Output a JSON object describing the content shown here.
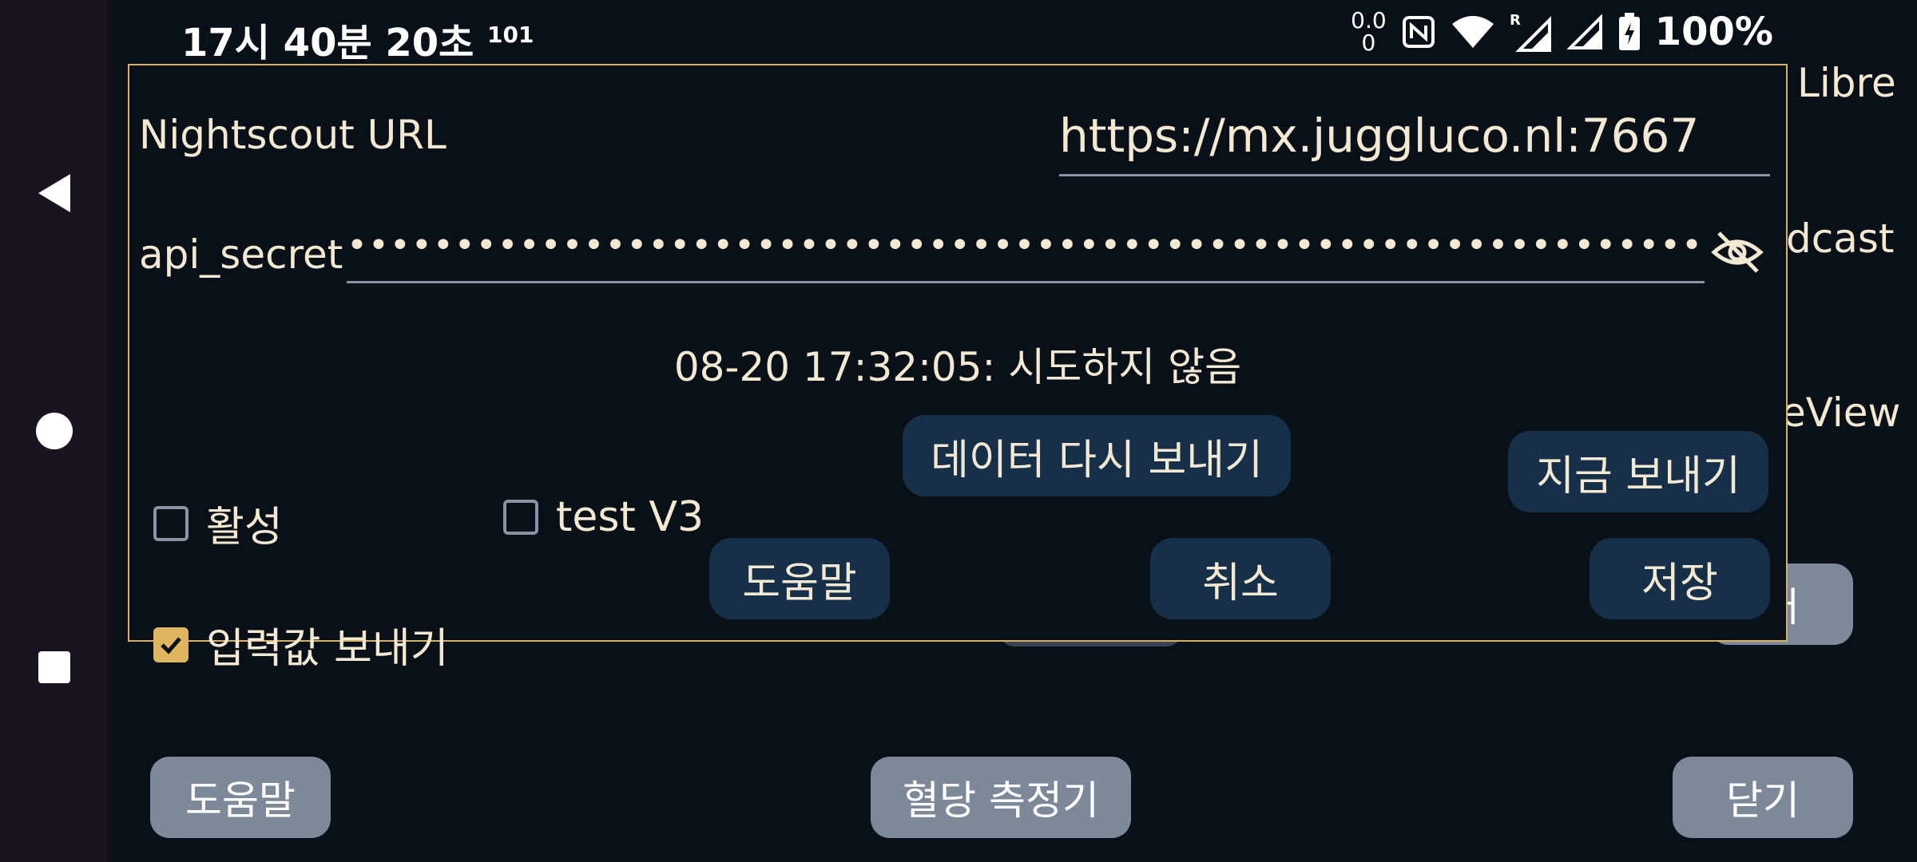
{
  "status_bar": {
    "time": "17시 40분 20초",
    "time_sup": "101",
    "net_speed_top": "0.0",
    "net_speed_bottom": "0",
    "battery": "100%",
    "icons": [
      "nfc-icon",
      "wifi-icon",
      "signal-roaming-icon",
      "signal-icon",
      "battery-charging-icon"
    ]
  },
  "background": {
    "libre": "Libre",
    "broadcast": "dcast",
    "eview": "eView",
    "right_button": "러",
    "help_button": "도움말",
    "meter_button": "혈당 측정기",
    "close_button": "닫기"
  },
  "dialog": {
    "url_label": "Nightscout URL",
    "url_value": "https://mx.juggluco.nl:7667",
    "secret_label": "api_secret",
    "secret_value": "••••••••••••••••••••••••••••••••••••••••••••••••••••••••••••••••••••••••",
    "status": "08-20 17:32:05: 시도하지 않음",
    "active_label": "활성",
    "active_checked": false,
    "testv3_label": "test V3",
    "testv3_checked": false,
    "send_input_label": "입력값 보내기",
    "send_input_checked": true,
    "resend_button": "데이터 다시 보내기",
    "send_now_button": "지금 보내기",
    "help_button": "도움말",
    "cancel_button": "취소",
    "save_button": "저장"
  },
  "colors": {
    "background": "#0a1018",
    "accent": "#e0b560",
    "button": "#17304a",
    "text": "#f3e9d2"
  }
}
